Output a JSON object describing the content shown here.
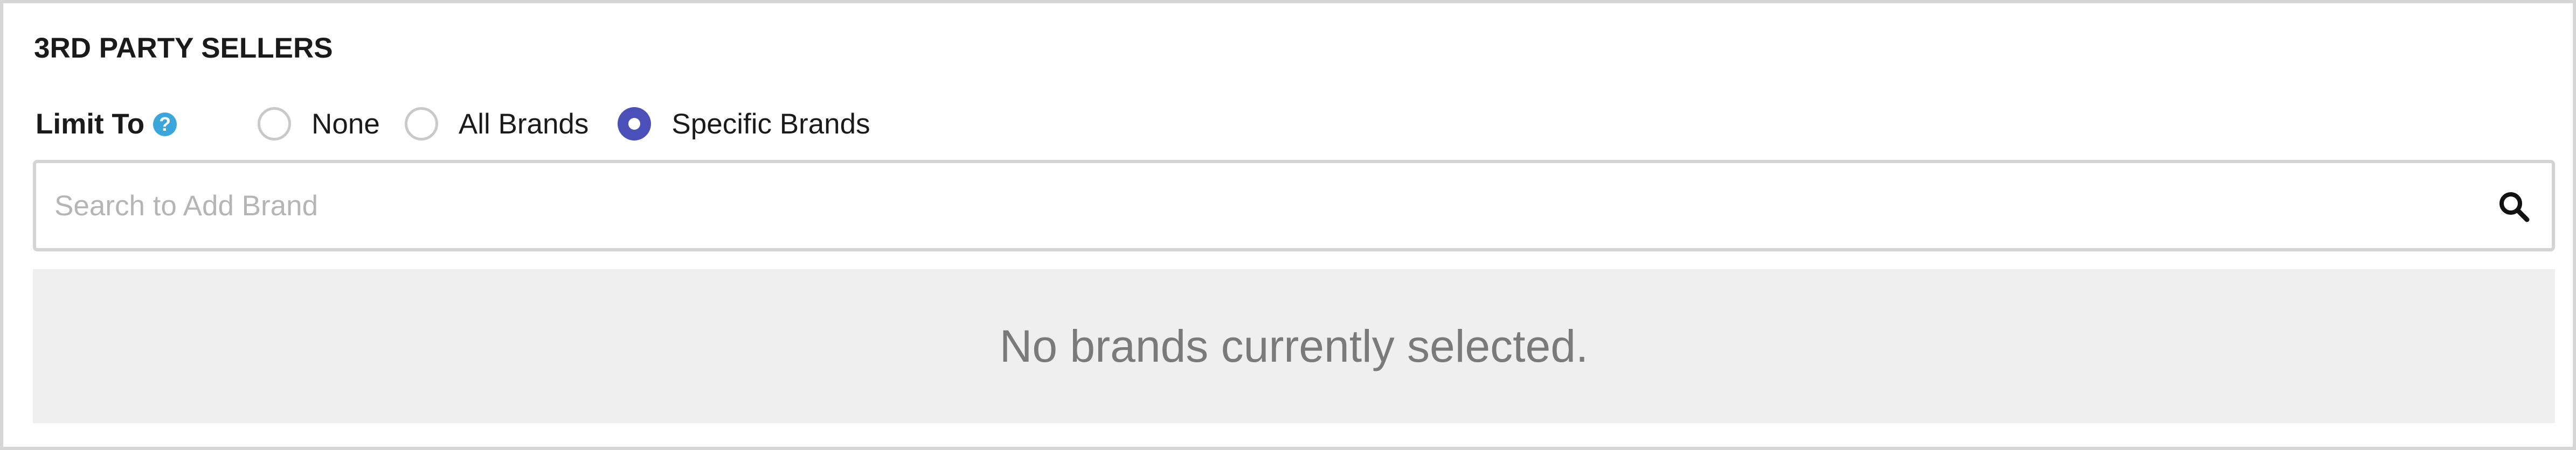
{
  "section": {
    "title": "3RD PARTY SELLERS"
  },
  "limit_to": {
    "label": "Limit To",
    "help_glyph": "?",
    "options": [
      {
        "label": "None",
        "selected": false
      },
      {
        "label": "All Brands",
        "selected": false
      },
      {
        "label": "Specific Brands",
        "selected": true
      }
    ]
  },
  "search": {
    "placeholder": "Search to Add Brand",
    "value": "",
    "icon": "search-icon"
  },
  "brands": {
    "empty_message": "No brands currently selected."
  },
  "colors": {
    "accent": "#4a50b8",
    "help_icon": "#3aa6dc",
    "empty_bg": "#efefef",
    "border": "#d6d6d6"
  }
}
